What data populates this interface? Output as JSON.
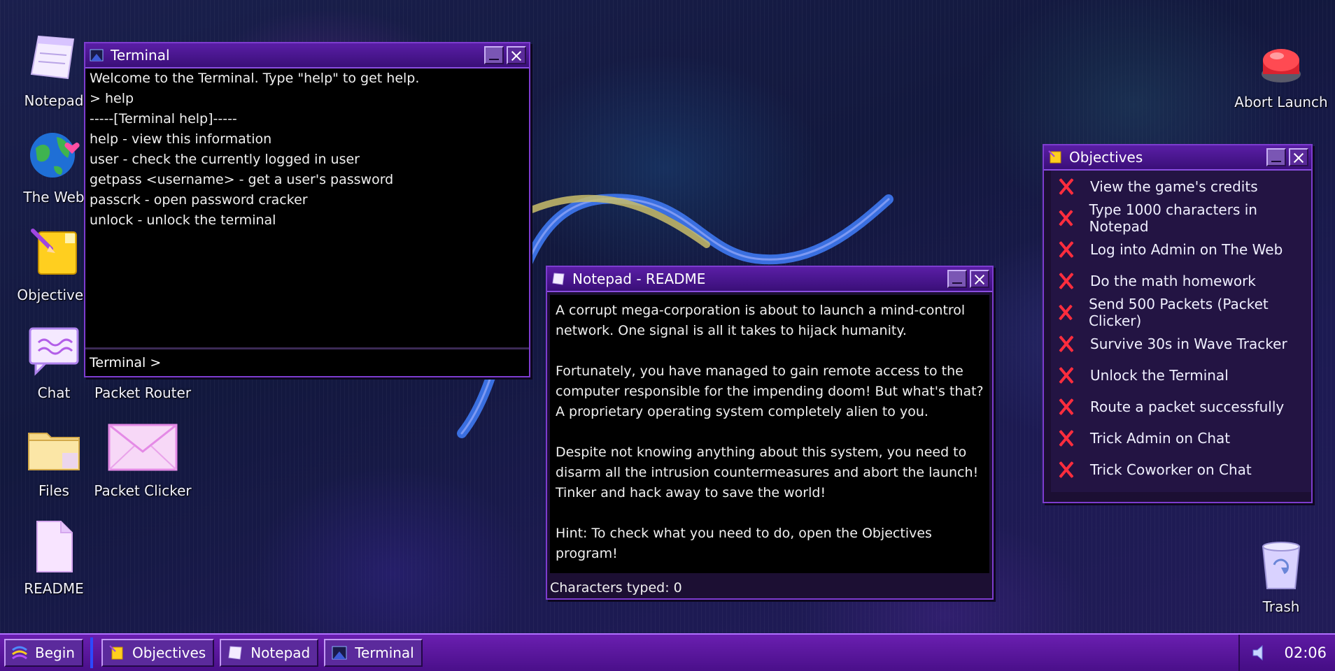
{
  "desktop": {
    "icons": {
      "notepad": "Notepad",
      "web": "The Web",
      "objectives": "Objectives",
      "chat": "Chat",
      "packet_router": "Packet Router",
      "files": "Files",
      "packet_clicker": "Packet Clicker",
      "readme": "README",
      "abort_launch": "Abort Launch",
      "trash": "Trash"
    }
  },
  "terminal": {
    "title": "Terminal",
    "lines": [
      "Welcome to the Terminal. Type \"help\" to get help.",
      "> help",
      "-----[Terminal help]-----",
      "help - view this information",
      "user - check the currently logged in user",
      "getpass <username> - get a user's password",
      "passcrk - open password cracker",
      "unlock - unlock the terminal"
    ],
    "prompt": "Terminal >"
  },
  "notepad": {
    "title": "Notepad - README",
    "paragraphs": [
      "A corrupt mega-corporation is about to launch a mind-control network. One signal is all it takes to hijack humanity.",
      "Fortunately, you have managed to gain remote access to the computer responsible for the impending doom! But what's that? A proprietary operating system completely alien to you.",
      "Despite not knowing anything about this system, you need to disarm all the intrusion countermeasures and abort the launch! Tinker and hack away to save the world!",
      "Hint: To check what you need to do, open the Objectives program!"
    ],
    "status": "Characters typed: 0"
  },
  "objectives": {
    "title": "Objectives",
    "items": [
      "View the game's credits",
      "Type 1000 characters in Notepad",
      "Log into Admin on The Web",
      "Do the math homework",
      "Send 500 Packets (Packet Clicker)",
      "Survive 30s in Wave Tracker",
      "Unlock the Terminal",
      "Route a packet successfully",
      "Trick Admin on Chat",
      "Trick Coworker on Chat"
    ]
  },
  "taskbar": {
    "start": "Begin",
    "buttons": [
      "Objectives",
      "Notepad",
      "Terminal"
    ],
    "clock": "02:06"
  },
  "colors": {
    "accent": "#7d3ccf",
    "taskbar": "#5a14a0",
    "objective_incomplete": "#ff2d3d"
  }
}
